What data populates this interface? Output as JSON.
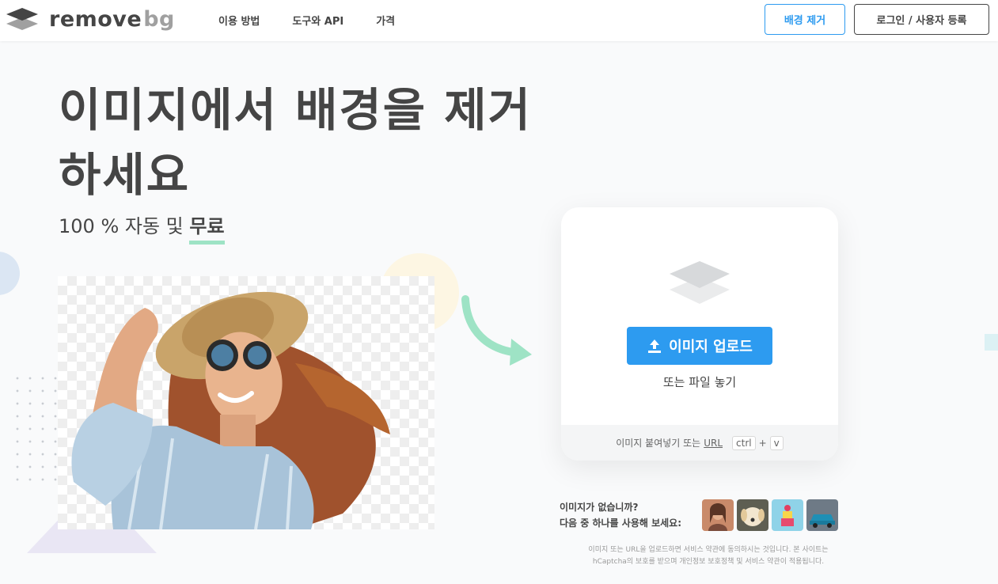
{
  "header": {
    "logo": {
      "word1": "remove",
      "word2": "bg",
      "icon": "layers-logo-icon"
    },
    "nav": [
      "이용 방법",
      "도구와 API",
      "가격"
    ],
    "remove_bg_button": "배경 제거",
    "login_button": "로그인 / 사용자 등록"
  },
  "hero": {
    "title": "이미지에서 배경을 제거하세요",
    "subtitle_prefix": "100 % 자동 및 ",
    "subtitle_highlight": "무료"
  },
  "demo": {
    "icon": "woman-sunhat-cutout-image"
  },
  "upload": {
    "icon": "layers-icon",
    "button_label": "이미지 업로드",
    "button_icon": "upload-icon",
    "drop_text": "또는 파일 놓기",
    "paste_text": "이미지 붙여넣기 또는",
    "url_label": "URL",
    "key1": "ctrl",
    "plus": "+",
    "key2": "v"
  },
  "samples": {
    "line1": "이미지가 없습니까?",
    "line2": "다음 중 하나를 사용해 보세요:",
    "thumbnails": [
      "woman-thumbnail",
      "dog-thumbnail",
      "cake-thumbnail",
      "car-thumbnail"
    ]
  },
  "legal": {
    "line1": "이미지 또는 URL을 업로드하면 서비스 약관에 동의하시는 것입니다. 본 사이트는",
    "line2": "hCaptcha의 보호를 받으며 개인정보 보호정책 및 서비스 약관이 적용됩니다."
  },
  "colors": {
    "accent": "#2d9bf0",
    "text": "#454545",
    "highlight": "#9ee3c5"
  }
}
